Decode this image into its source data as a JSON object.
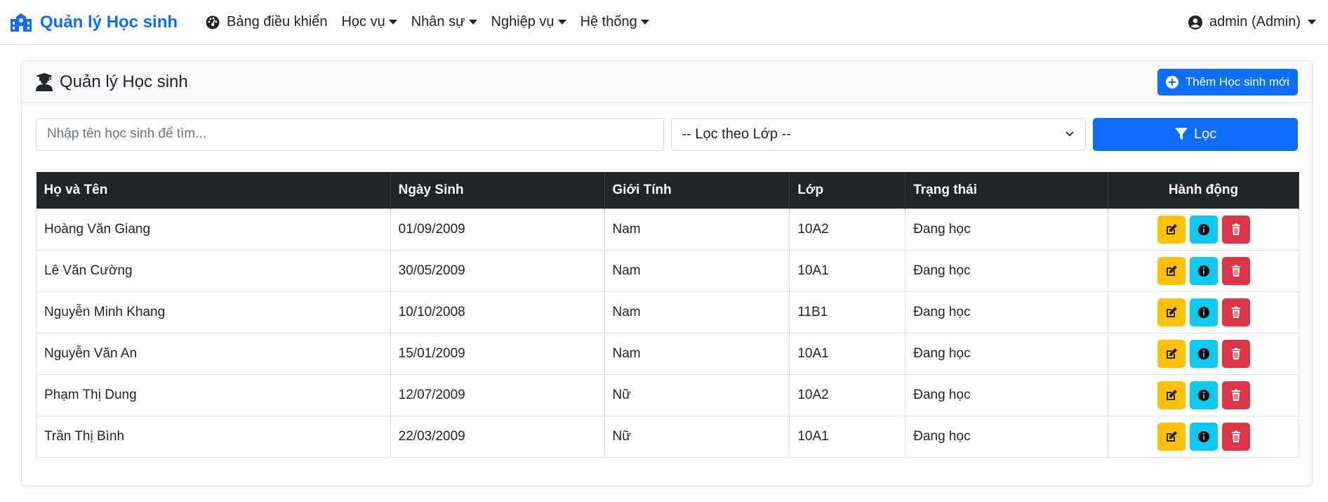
{
  "navbar": {
    "brand": "Quản lý Học sinh",
    "items": [
      {
        "label": "Bảng điều khiển",
        "dropdown": false
      },
      {
        "label": "Học vụ",
        "dropdown": true
      },
      {
        "label": "Nhân sự",
        "dropdown": true
      },
      {
        "label": "Nghiệp vụ",
        "dropdown": true
      },
      {
        "label": "Hệ thống",
        "dropdown": true
      }
    ],
    "user": "admin (Admin)"
  },
  "card": {
    "title": "Quản lý Học sinh",
    "add_button": "Thêm Học sinh mới"
  },
  "filters": {
    "search_placeholder": "Nhập tên học sinh để tìm...",
    "class_select": "-- Lọc theo Lớp --",
    "filter_button": "Lọc"
  },
  "table": {
    "headers": [
      "Họ và Tên",
      "Ngày Sinh",
      "Giới Tính",
      "Lớp",
      "Trạng thái",
      "Hành động"
    ],
    "rows": [
      [
        "Hoàng Văn Giang",
        "01/09/2009",
        "Nam",
        "10A2",
        "Đang học"
      ],
      [
        "Lê Văn Cường",
        "30/05/2009",
        "Nam",
        "10A1",
        "Đang học"
      ],
      [
        "Nguyễn Minh Khang",
        "10/10/2008",
        "Nam",
        "11B1",
        "Đang học"
      ],
      [
        "Nguyễn Văn An",
        "15/01/2009",
        "Nam",
        "10A1",
        "Đang học"
      ],
      [
        "Phạm Thị Dung",
        "12/07/2009",
        "Nữ",
        "10A2",
        "Đang học"
      ],
      [
        "Trần Thị Bình",
        "22/03/2009",
        "Nữ",
        "10A1",
        "Đang học"
      ]
    ],
    "action_icons": [
      "edit-icon",
      "info-icon",
      "trash-icon"
    ]
  },
  "colors": {
    "primary": "#0d6efd",
    "warning": "#ffc107",
    "info": "#0dcaf0",
    "danger": "#dc3545",
    "dark": "#212529"
  }
}
